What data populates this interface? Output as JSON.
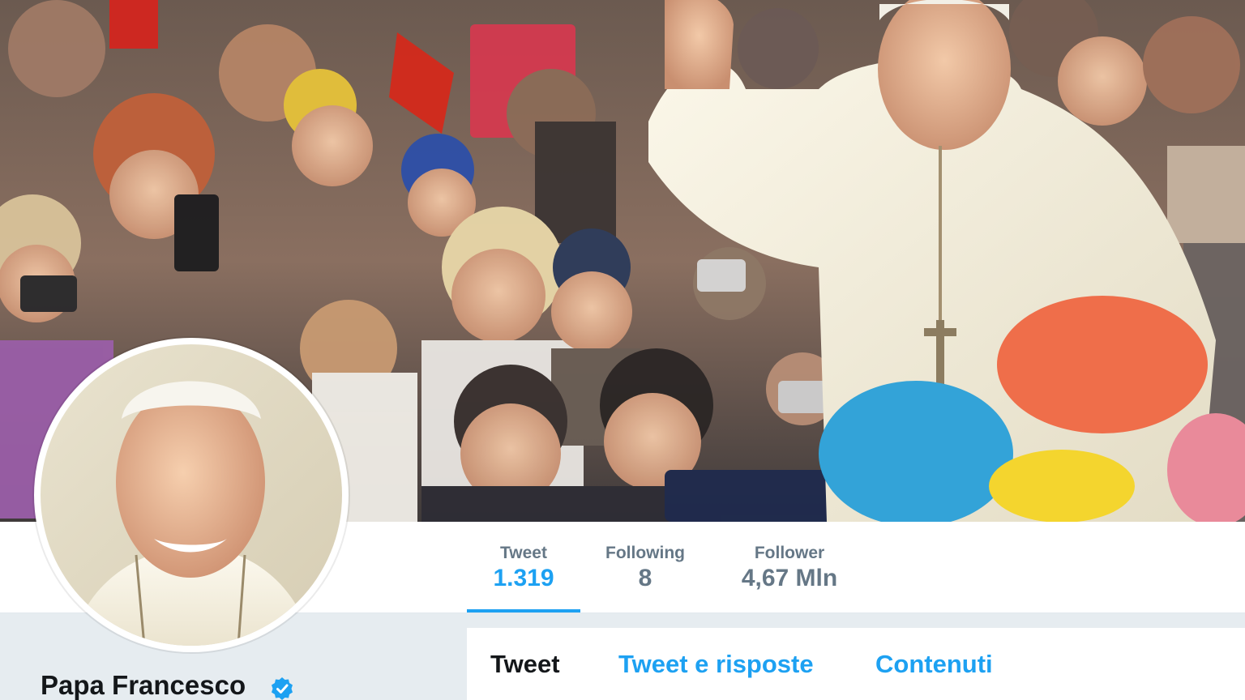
{
  "profile": {
    "name": "Papa Francesco",
    "verified": true
  },
  "stats": [
    {
      "label": "Tweet",
      "value": "1.319",
      "active": true
    },
    {
      "label": "Following",
      "value": "8",
      "active": false
    },
    {
      "label": "Follower",
      "value": "4,67 Mln",
      "active": false
    }
  ],
  "tabs": [
    {
      "label": "Tweet",
      "active": true
    },
    {
      "label": "Tweet e risposte",
      "active": false
    },
    {
      "label": "Contenuti",
      "active": false
    }
  ],
  "colors": {
    "accent": "#1da1f2",
    "text_dark": "#14171a",
    "text_muted": "#657786",
    "background_gray": "#e6ecf0"
  },
  "icons": {
    "verified": "verified-badge-icon"
  }
}
